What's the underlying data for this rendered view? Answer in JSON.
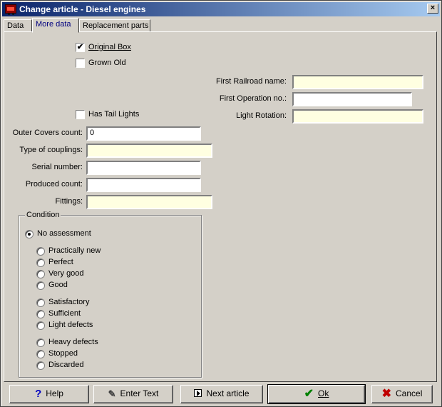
{
  "window": {
    "title": "Change article - Diesel engines",
    "close_label": "×"
  },
  "tabs": [
    {
      "label": "Data"
    },
    {
      "label": "More data",
      "active": true
    },
    {
      "label": "Replacement parts"
    }
  ],
  "checkboxes": {
    "original_box": {
      "label": "Original Box",
      "checked": true
    },
    "grown_old": {
      "label": "Grown Old",
      "checked": false
    },
    "has_tail_lights": {
      "label": "Has Tail Lights",
      "checked": false
    }
  },
  "right_fields": {
    "first_railroad_name": {
      "label": "First Railroad name:",
      "value": ""
    },
    "first_operation_no": {
      "label": "First Operation no.:",
      "value": ""
    },
    "light_rotation": {
      "label": "Light Rotation:",
      "value": ""
    }
  },
  "left_fields": {
    "outer_covers_count": {
      "label": "Outer Covers count:",
      "value": "0"
    },
    "type_of_couplings": {
      "label": "Type of couplings:",
      "value": ""
    },
    "serial_number": {
      "label": "Serial number:",
      "value": ""
    },
    "produced_count": {
      "label": "Produced count:",
      "value": ""
    },
    "fittings": {
      "label": "Fittings:",
      "value": ""
    }
  },
  "condition": {
    "title": "Condition",
    "selected": "No assessment",
    "options": [
      "No assessment",
      "Practically new",
      "Perfect",
      "Very good",
      "Good",
      "Satisfactory",
      "Sufficient",
      "Light defects",
      "Heavy defects",
      "Stopped",
      "Discarded"
    ]
  },
  "buttons": {
    "help": "Help",
    "enter_text": "Enter Text",
    "next_article": "Next article",
    "ok": "Ok",
    "cancel": "Cancel"
  },
  "icons": {
    "check_mark": "✔",
    "help": "?",
    "pen": "✎",
    "ok": "✔",
    "cancel": "✖"
  },
  "colors": {
    "title_start": "#0a246a",
    "title_end": "#a6caf0",
    "face": "#d4d0c8",
    "field_yellow": "#ffffe1",
    "active_tab_text": "#00007f"
  }
}
